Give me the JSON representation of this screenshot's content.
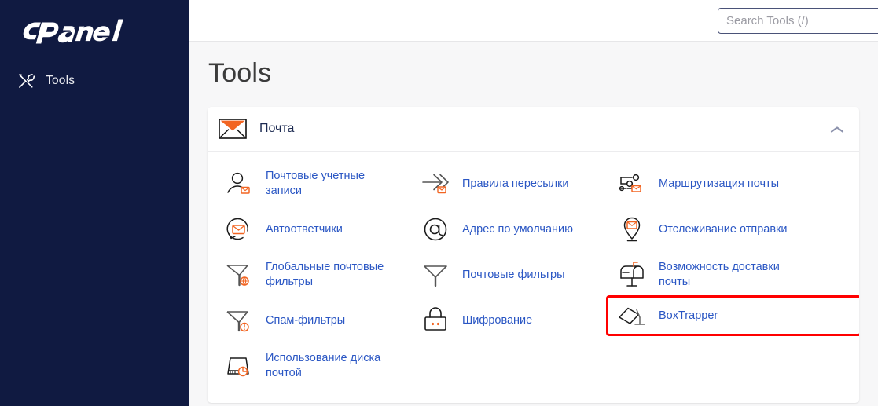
{
  "brand": {
    "name": "cPanel"
  },
  "sidebar": {
    "items": [
      {
        "label": "Tools",
        "icon": "tools-icon",
        "active": true
      }
    ]
  },
  "topbar": {
    "search": {
      "placeholder": "Search Tools (/)",
      "value": ""
    }
  },
  "page": {
    "title": "Tools"
  },
  "panel": {
    "title": "Почта",
    "icon": "envelope-icon",
    "collapse_icon": "chevron-up-icon",
    "expanded": true,
    "tools": [
      {
        "label": "Почтовые учетные записи",
        "icon": "mail-accounts-icon",
        "highlighted": false
      },
      {
        "label": "Правила пересылки",
        "icon": "forwarders-icon",
        "highlighted": false
      },
      {
        "label": "Маршрутизация почты",
        "icon": "email-routing-icon",
        "highlighted": false
      },
      {
        "label": "Автоответчики",
        "icon": "autoresponders-icon",
        "highlighted": false
      },
      {
        "label": "Адрес по умолчанию",
        "icon": "default-address-icon",
        "highlighted": false
      },
      {
        "label": "Отслеживание отправки",
        "icon": "track-delivery-icon",
        "highlighted": false
      },
      {
        "label": "Глобальные почтовые фильтры",
        "icon": "global-filters-icon",
        "highlighted": false
      },
      {
        "label": "Почтовые фильтры",
        "icon": "email-filters-icon",
        "highlighted": false
      },
      {
        "label": "Возможность доставки почты",
        "icon": "deliverability-icon",
        "highlighted": false
      },
      {
        "label": "Спам-фильтры",
        "icon": "spam-filters-icon",
        "highlighted": false
      },
      {
        "label": "Шифрование",
        "icon": "encryption-icon",
        "highlighted": false
      },
      {
        "label": "BoxTrapper",
        "icon": "boxtrapper-icon",
        "highlighted": true
      },
      {
        "label": "Использование диска почтой",
        "icon": "email-disk-usage-icon",
        "highlighted": false
      }
    ]
  },
  "colors": {
    "sidebar_bg": "#101a41",
    "link": "#2b57c4",
    "accent_orange": "#f26522",
    "highlight_red": "#ff0000",
    "content_bg": "#f7f7f8",
    "panel_bg": "#ffffff"
  }
}
